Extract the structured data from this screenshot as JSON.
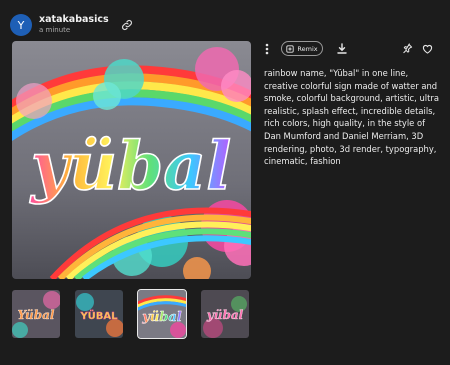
{
  "user": {
    "avatar_initial": "Y",
    "username": "xatakabasics",
    "time": "a minute"
  },
  "main_image": {
    "lettering": "yübal"
  },
  "toolbar": {
    "remix_label": "Remix"
  },
  "prompt": "rainbow name, \"Yübal\" in one line, creative colorful sign made of watter and smoke, colorful background, artistic, ultra realistic, splash effect, incredible details, rich colors, high quality, in the style of Dan Mumford and Daniel Merriam, 3D rendering, photo, 3d render, typography, cinematic, fashion",
  "thumbnails": [
    {
      "lettering": "Yübal",
      "selected": false
    },
    {
      "lettering": "YÜBAL",
      "selected": false
    },
    {
      "lettering": "yübal",
      "selected": true
    },
    {
      "lettering": "yübal",
      "selected": false
    }
  ],
  "colors": {
    "background": "#1c1c1c",
    "avatar": "#1e5fb6",
    "text": "#e8e8e8"
  }
}
